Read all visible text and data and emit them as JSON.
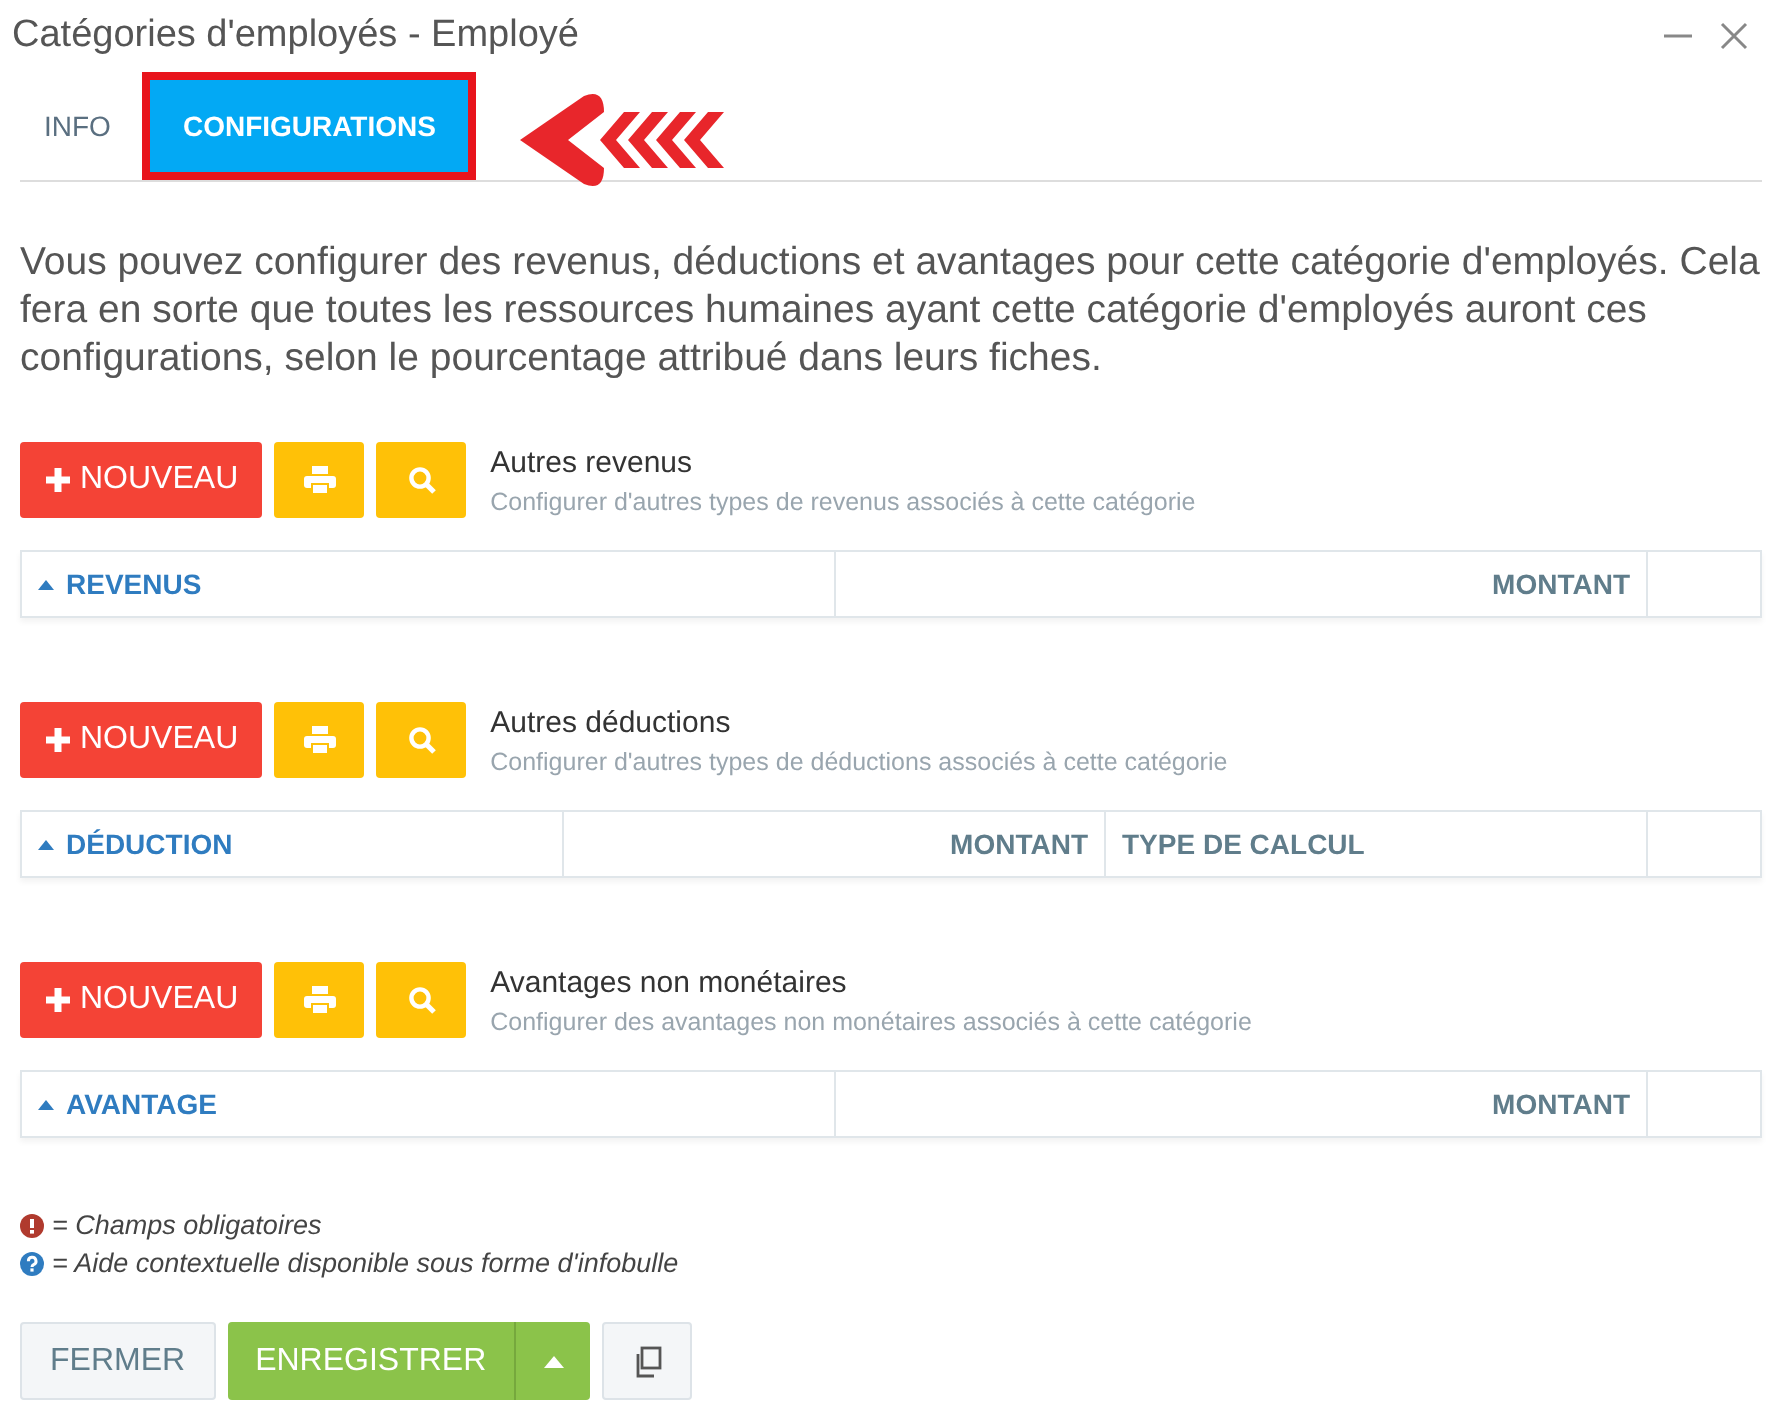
{
  "window": {
    "title": "Catégories d'employés - Employé"
  },
  "tabs": [
    {
      "label": "INFO",
      "selected": false,
      "highlighted": false
    },
    {
      "label": "CONFIGURATIONS",
      "selected": true,
      "highlighted": true
    }
  ],
  "intro": "Vous pouvez configurer des revenus, déductions et avantages pour cette catégorie d'employés. Cela fera en sorte que toutes les ressources humaines ayant cette catégorie d'employés auront ces configurations, selon le pourcentage attribué dans leurs fiches.",
  "sections": [
    {
      "new_button": "NOUVEAU",
      "title": "Autres revenus",
      "subtitle": "Configurer d'autres types de revenus associés à cette catégorie",
      "columns": [
        {
          "label": "REVENUS",
          "kind": "sort"
        },
        {
          "label": "MONTANT",
          "kind": "right"
        }
      ]
    },
    {
      "new_button": "NOUVEAU",
      "title": "Autres déductions",
      "subtitle": "Configurer d'autres types de déductions associés à cette catégorie",
      "columns": [
        {
          "label": "DÉDUCTION",
          "kind": "sort"
        },
        {
          "label": "MONTANT",
          "kind": "right"
        },
        {
          "label": "TYPE DE CALCUL",
          "kind": "left"
        }
      ]
    },
    {
      "new_button": "NOUVEAU",
      "title": "Avantages non monétaires",
      "subtitle": "Configurer des avantages non monétaires associés à cette catégorie",
      "columns": [
        {
          "label": "AVANTAGE",
          "kind": "sort"
        },
        {
          "label": "MONTANT",
          "kind": "right"
        }
      ]
    }
  ],
  "legend": [
    {
      "kind": "required",
      "text": "= Champs obligatoires"
    },
    {
      "kind": "help",
      "text": "= Aide contextuelle disponible sous forme d'infobulle"
    }
  ],
  "footer": {
    "close": "FERMER",
    "save": "ENREGISTRER"
  }
}
